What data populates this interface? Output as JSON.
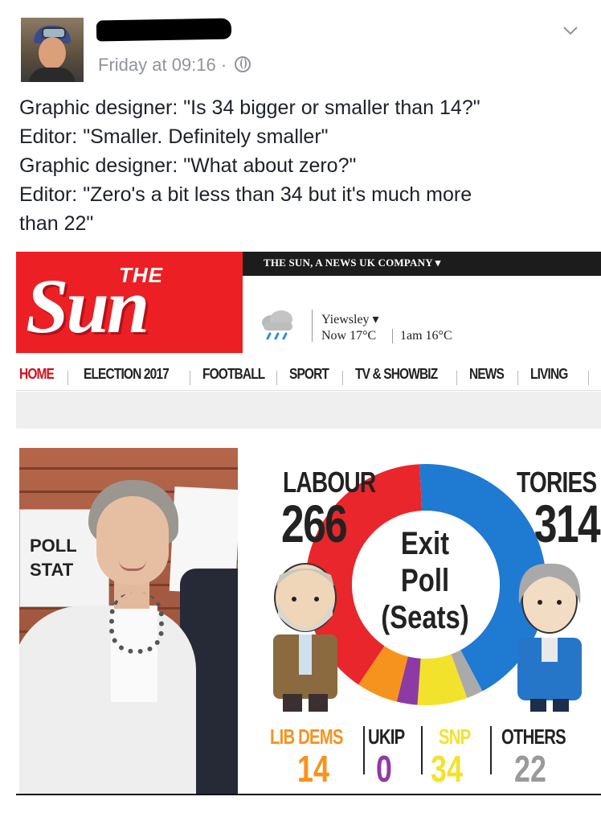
{
  "post": {
    "time": "Friday at 09:16 · ",
    "lines": [
      "Graphic designer: \"Is 34 bigger or smaller than 14?\"",
      "Editor: \"Smaller. Definitely smaller\"",
      "Graphic designer: \"What about zero?\"",
      "Editor: \"Zero's a bit less than 34 but it's much more",
      "than 22\""
    ]
  },
  "sun": {
    "topbar": "THE SUN, A NEWS UK COMPANY ▾",
    "logo_the": "THE",
    "logo_sun": "Sun",
    "location": "Yiewsley ▾",
    "weather_now": "Now 17°C",
    "weather_later": "1am 16°C",
    "nav": [
      "HOME",
      "ELECTION 2017",
      "FOOTBALL",
      "SPORT",
      "TV & SHOWBIZ",
      "NEWS",
      "LIVING"
    ],
    "photo_sign": [
      "POLL",
      "STAT"
    ]
  },
  "graphic": {
    "center": [
      "Exit",
      "Poll",
      "(Seats)"
    ],
    "labour": {
      "label": "LABOUR",
      "seats": "266",
      "color": "#e8262c"
    },
    "tories": {
      "label": "TORIES",
      "seats": "314",
      "color": "#1f7ad1"
    },
    "libdems": {
      "label": "LIB DEMS",
      "seats": "14",
      "color": "#f6931e"
    },
    "ukip": {
      "label": "UKIP",
      "seats": "0",
      "color": "#8e3aa4"
    },
    "snp": {
      "label": "SNP",
      "seats": "34",
      "color": "#f3e22c"
    },
    "others": {
      "label": "OTHERS",
      "seats": "22",
      "color": "#aaaaaa"
    }
  }
}
